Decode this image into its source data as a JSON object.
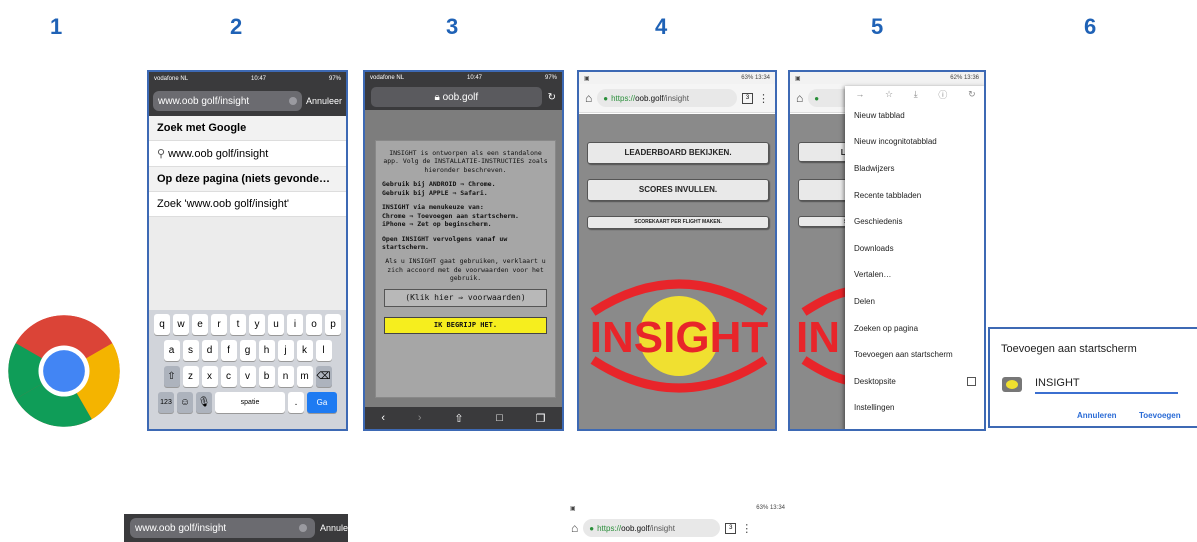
{
  "steps": [
    "1",
    "2",
    "3",
    "4",
    "5",
    "6"
  ],
  "colors": {
    "step_number": "#1f62b6",
    "border": "#3d69b4",
    "ok_button": "#f6ee1e",
    "logo_red": "#e8252a",
    "logo_yellow": "#f0e030"
  },
  "screen2": {
    "status_carrier": "vodafone NL",
    "status_time": "10:47",
    "status_battery": "97%",
    "url_value": "www.oob golf/insight",
    "cancel": "Annuleer",
    "heading1": "Zoek met Google",
    "suggestion": "www.oob golf/insight",
    "heading2": "Op deze pagina (niets gevonde…",
    "find_row": "Zoek 'www.oob golf/insight'",
    "keys_row1": [
      "q",
      "w",
      "e",
      "r",
      "t",
      "y",
      "u",
      "i",
      "o",
      "p"
    ],
    "keys_row2": [
      "a",
      "s",
      "d",
      "f",
      "g",
      "h",
      "j",
      "k",
      "l"
    ],
    "keys_row3": [
      "z",
      "x",
      "c",
      "v",
      "b",
      "n",
      "m"
    ],
    "key_123": "123",
    "key_space": "spatie",
    "key_go": "Ga"
  },
  "screen3": {
    "status_carrier": "vodafone NL",
    "status_time": "10:47",
    "status_battery": "97%",
    "url_value": "oob.golf",
    "p1": "INSIGHT is ontworpen als een standalone app. Volg de INSTALLATIE-INSTRUCTIES zoals hieronder beschreven.",
    "p2_line1": "Gebruik bij ANDROID ⇒ Chrome.",
    "p2_line2": "Gebruik bij APPLE ⇒ Safari.",
    "p3_line1": "INSIGHT via menukeuze van:",
    "p3_line2": "Chrome ⇒ Toevoegen aan startscherm.",
    "p3_line3": "iPhone ⇒ Zet op beginscherm.",
    "p4": "Open INSIGHT vervolgens vanaf uw startscherm.",
    "p5": "Als u INSIGHT gaat gebruiken, verklaart u zich accoord met de voorwaarden voor het gebruik.",
    "terms_button": "(Klik hier ⇒ voorwaarden)",
    "ok_button": "IK BEGRIJP HET."
  },
  "screen4": {
    "status_text": "63% 13:34",
    "url_scheme": "https://",
    "url_host": "oob.golf",
    "url_path": "/insight",
    "tab_count": "3",
    "btn_leaderboard": "LEADERBOARD BEKIJKEN.",
    "btn_scores": "SCORES INVULLEN.",
    "btn_scorecard": "SCOREKAART PER FLIGHT MAKEN.",
    "logo_text": "INSIGHT"
  },
  "screen5": {
    "status_text": "62% 13:36",
    "menu_items": [
      "Nieuw tabblad",
      "Nieuw incognitotabblad",
      "Bladwijzers",
      "Recente tabbladen",
      "Geschiedenis",
      "Downloads",
      "Vertalen…",
      "Delen",
      "Zoeken op pagina",
      "Toevoegen aan startscherm",
      "Desktopsite",
      "Instellingen"
    ],
    "bg_btn1_partial": "LE",
    "bg_btn3_partial": "SC",
    "bg_logo_partial": "IN"
  },
  "screen6": {
    "title": "Toevoegen aan startscherm",
    "input_value": "INSIGHT",
    "cancel": "Annuleren",
    "confirm": "Toevoegen"
  },
  "crop_ios": {
    "url_value": "www.oob golf/insight",
    "cancel": "Annulee"
  },
  "crop_android": {
    "status_text": "63% 13:34",
    "url_scheme": "https://",
    "url_host": "oob.golf",
    "url_path": "/insight",
    "tab_count": "3"
  }
}
